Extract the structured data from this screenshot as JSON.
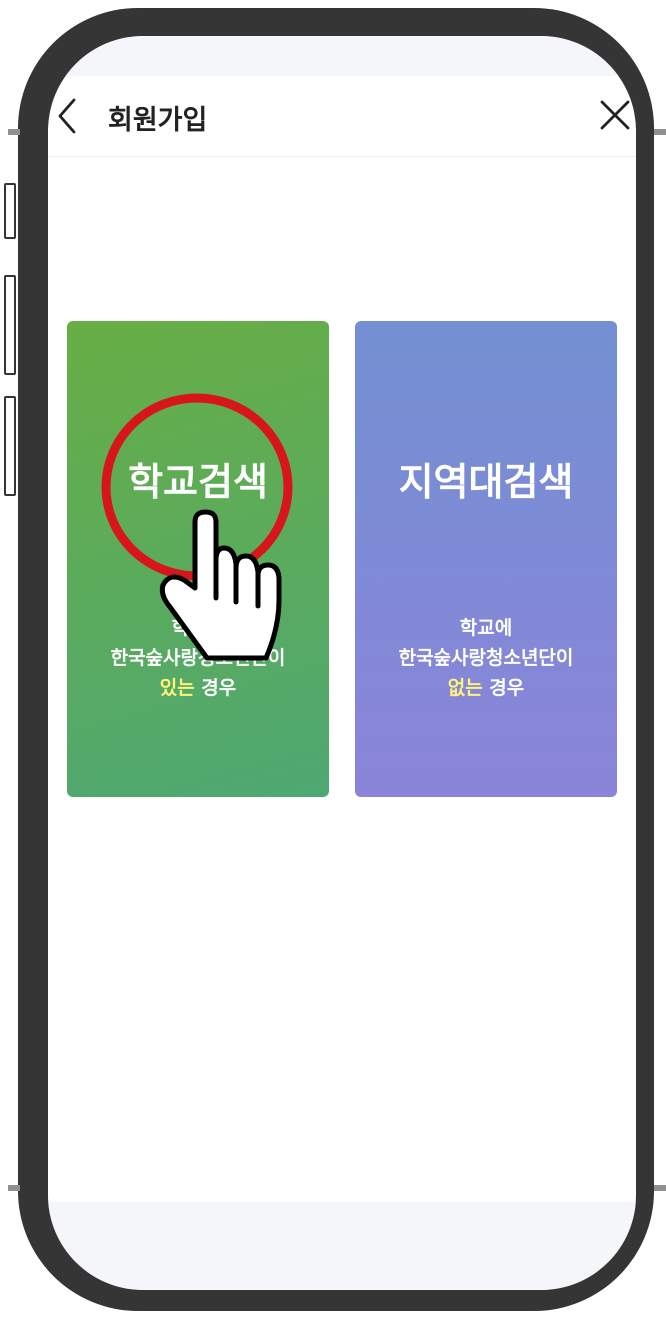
{
  "header": {
    "title": "회원가입"
  },
  "cards": [
    {
      "title": "학교검색",
      "desc_line1": "학교에",
      "desc_line2": "한국숲사랑청소년단이",
      "desc_highlight": "있는",
      "desc_suffix": " 경우"
    },
    {
      "title": "지역대검색",
      "desc_line1": "학교에",
      "desc_line2": "한국숲사랑청소년단이",
      "desc_highlight": "없는",
      "desc_suffix": " 경우"
    }
  ],
  "colors": {
    "phone_frame": "#353535",
    "school_card_top": "#68ae45",
    "school_card_bottom": "#4fa873",
    "region_card_top": "#7390d2",
    "region_card_bottom": "#8b84d9",
    "highlight_text": "#fff47a",
    "annotation_circle": "#d7161c"
  },
  "icons": {
    "back": "chevron-left-icon",
    "close": "close-icon",
    "pointer": "hand-pointer-icon"
  }
}
